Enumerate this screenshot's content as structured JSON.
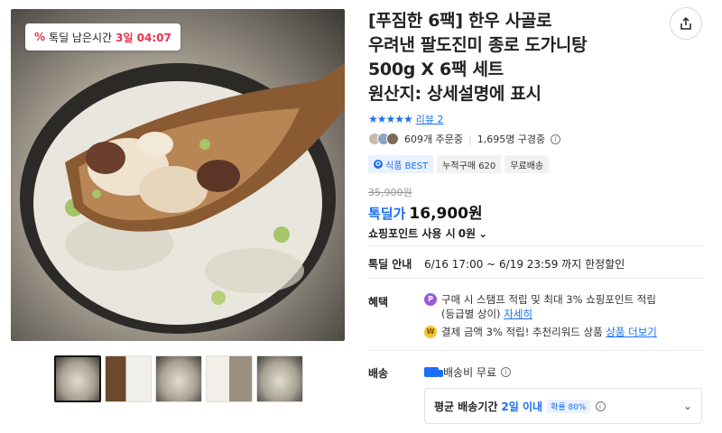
{
  "gallery": {
    "timer_label": "톡딜 남은시간",
    "timer_value": "3일 04:07",
    "thumbnail_count": 5
  },
  "product": {
    "title_lines": [
      "[푸짐한 6팩] 한우 사골로",
      "우려낸 팔도진미 종로 도가니탕",
      "500g X 6팩 세트",
      "원산지: 상세설명에 표시"
    ],
    "rating_stars": 4.5,
    "review_label": "리뷰 2",
    "orders": "609개 주문중",
    "subscribers": "1,695명 구경중"
  },
  "badges": [
    "식품 BEST",
    "누적구매 620",
    "무료배송"
  ],
  "price": {
    "original": "35,900원",
    "deal_label": "톡딜가",
    "current": "16,900원",
    "points_label": "쇼핑포인트 사용 시",
    "points_value": "0원"
  },
  "deal_info": {
    "label": "톡딜 안내",
    "period": "6/16 17:00 ~ 6/19 23:59 까지 한정할인"
  },
  "benefits": {
    "label": "혜택",
    "item1_text": "구매 시 스탬프 적립 및 최대 3% 쇼핑포인트 적립",
    "item1_sub": "(등급별 상이)",
    "item1_link": "자세히",
    "item2_text": "결제 금액 3% 적립! 추천리워드 상품",
    "item2_link": "상품 더보기"
  },
  "shipping": {
    "label": "배송",
    "fee": "배송비 무료",
    "avg_label": "평균 배송기간",
    "avg_value": "2일 이내",
    "probability": "확률 80%"
  },
  "colors": {
    "accent": "#1a6ff5",
    "timer_red": "#e8344e"
  }
}
